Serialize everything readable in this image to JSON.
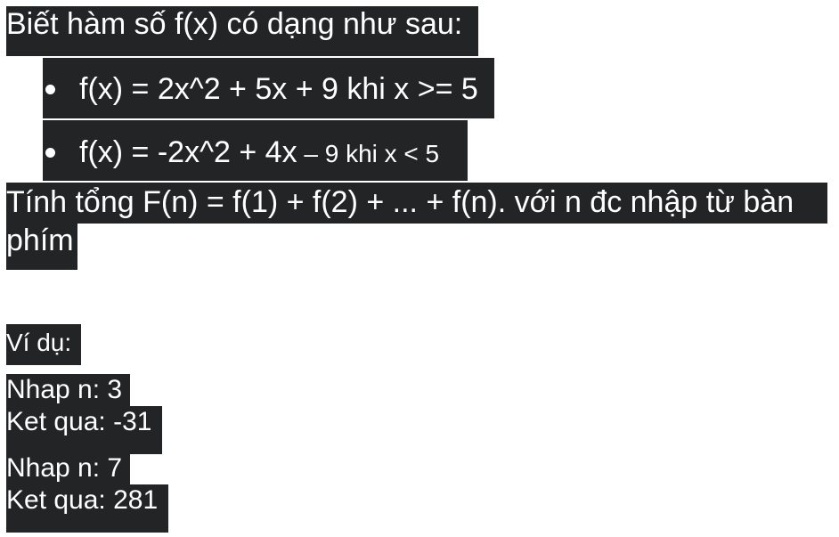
{
  "intro": "Biết hàm số f(x) có dạng như sau:",
  "cases": [
    {
      "formula": "f(x) = 2x^2 + 5x + 9 khi x >= 5"
    },
    {
      "formula_main": "f(x) = -2x^2 + 4x",
      "formula_tail": " – 9 khi x < 5"
    }
  ],
  "task_line1": "Tính tổng F(n) = f(1) + f(2) + ... + f(n). với n đc nhập từ bàn",
  "task_line2": "phím",
  "example_label": "Ví dụ:",
  "examples": [
    {
      "input": "Nhap n: 3",
      "output": "Ket qua: -31"
    },
    {
      "input": "Nhap n: 7",
      "output": "Ket qua: 281"
    }
  ]
}
